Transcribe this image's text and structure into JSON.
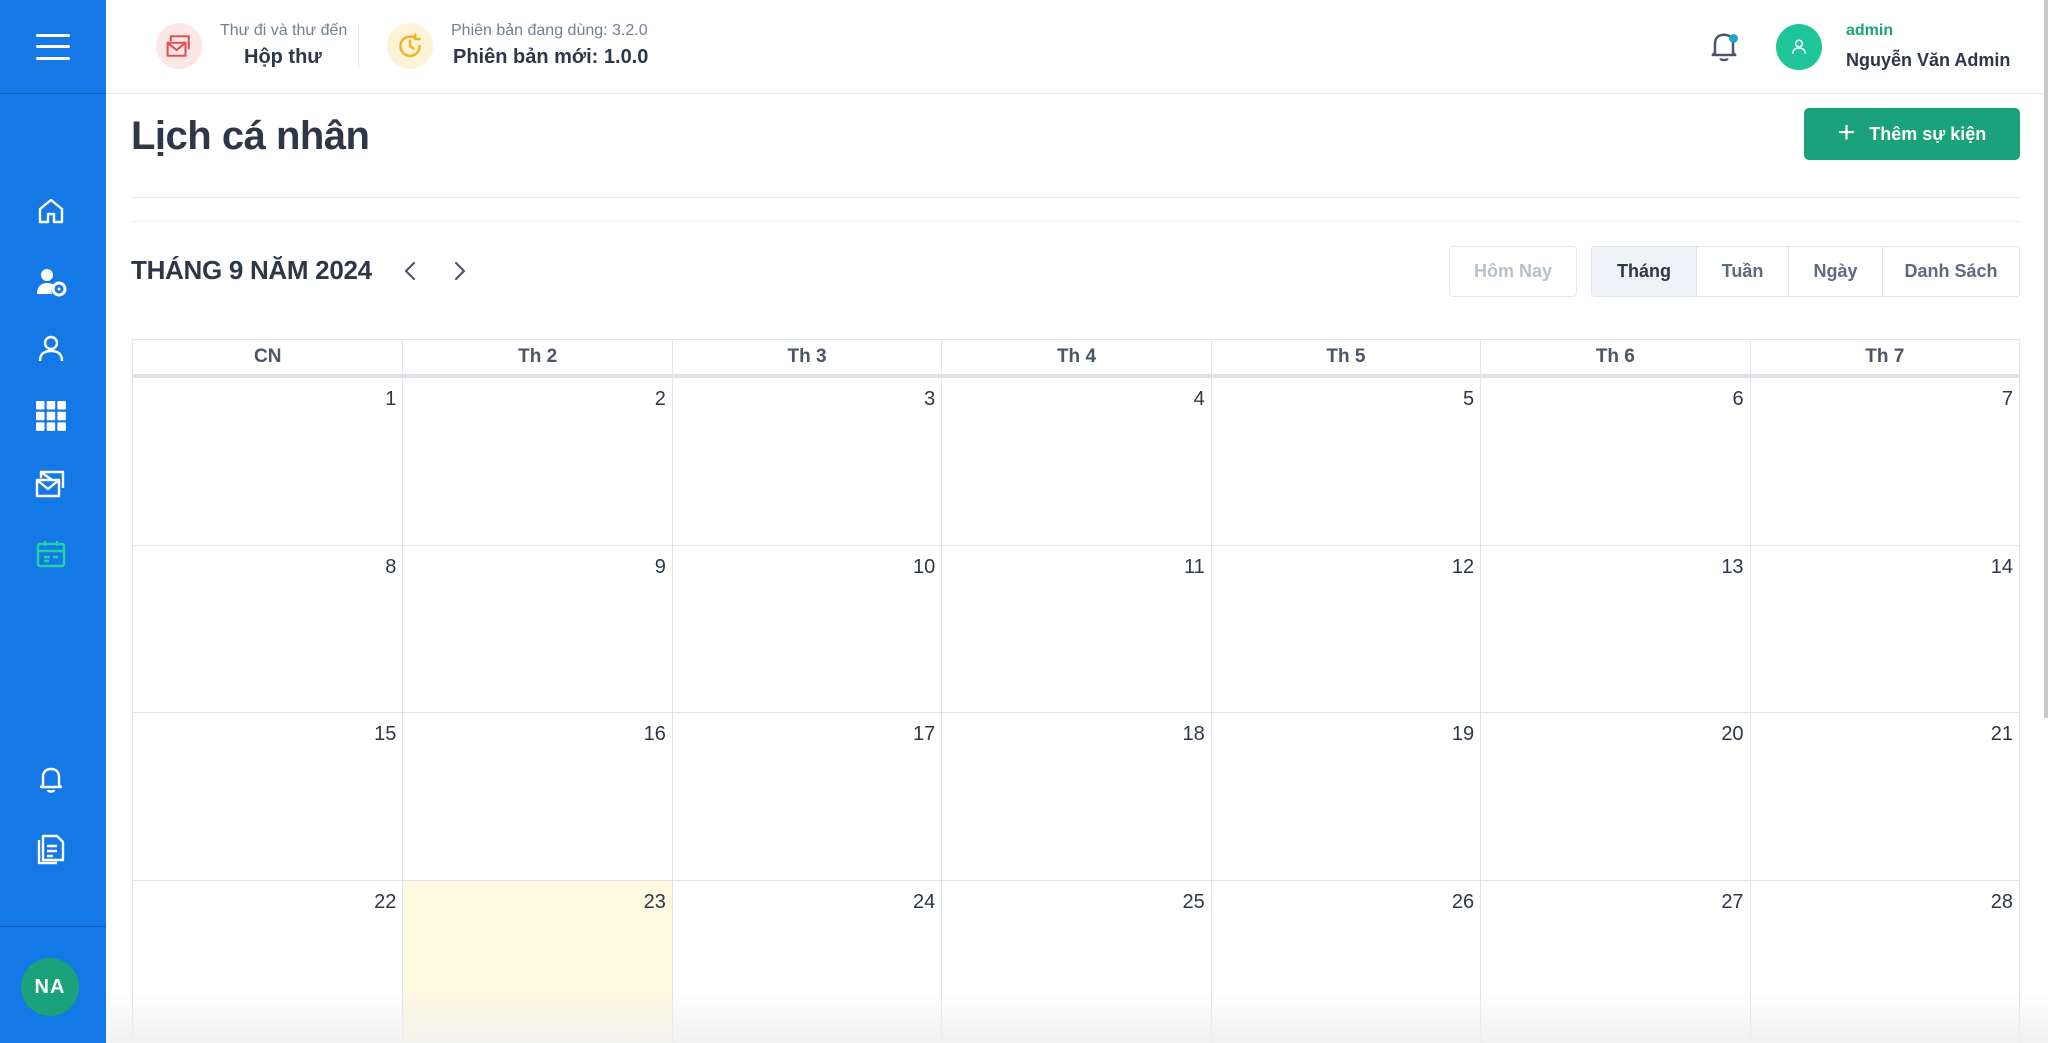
{
  "header": {
    "mail_small": "Thư đi và thư đến",
    "mail_big": "Hộp thư",
    "version_small": "Phiên bản đang dùng: 3.2.0",
    "version_big": "Phiên bản mới: 1.0.0",
    "user_role": "admin",
    "user_name": "Nguyễn Văn Admin"
  },
  "sidebar": {
    "items": [
      {
        "icon": "home-icon"
      },
      {
        "icon": "user-settings-icon"
      },
      {
        "icon": "user-icon"
      },
      {
        "icon": "grid-icon"
      },
      {
        "icon": "mail-icon"
      },
      {
        "icon": "calendar-icon",
        "active": true
      },
      {
        "icon": "bell-icon"
      },
      {
        "icon": "document-icon"
      }
    ],
    "avatar_initials": "NA"
  },
  "page": {
    "title": "Lịch cá nhân",
    "add_button": "Thêm sự kiện"
  },
  "calendar": {
    "month_title": "THÁNG 9 NĂM 2024",
    "today_label": "Hôm Nay",
    "views": [
      "Tháng",
      "Tuần",
      "Ngày",
      "Danh Sách"
    ],
    "active_view": "Tháng",
    "weekdays": [
      "CN",
      "Th 2",
      "Th 3",
      "Th 4",
      "Th 5",
      "Th 6",
      "Th 7"
    ],
    "weeks": [
      [
        "1",
        "2",
        "3",
        "4",
        "5",
        "6",
        "7"
      ],
      [
        "8",
        "9",
        "10",
        "11",
        "12",
        "13",
        "14"
      ],
      [
        "15",
        "16",
        "17",
        "18",
        "19",
        "20",
        "21"
      ],
      [
        "22",
        "23",
        "24",
        "25",
        "26",
        "27",
        "28"
      ]
    ],
    "today": "23"
  },
  "colors": {
    "sidebar": "#1478e6",
    "primary": "#1aa37a",
    "active_icon": "#1fd3a4",
    "today_bg": "#fef9e1"
  }
}
